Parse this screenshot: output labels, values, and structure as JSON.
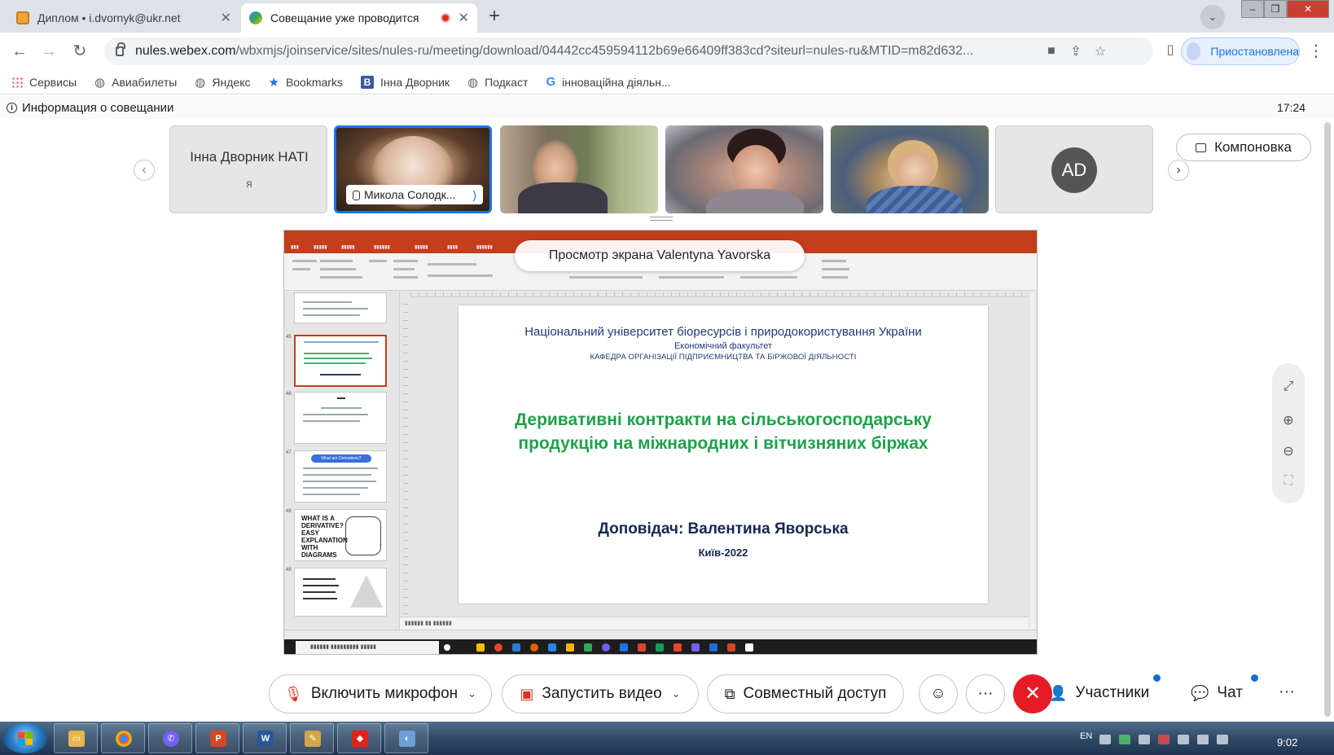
{
  "browser": {
    "tabs": [
      {
        "title": "Диплом • i.dvornyk@ukr.net"
      },
      {
        "title": "Совещание уже проводится"
      }
    ],
    "new_tab": "+",
    "address": {
      "host": "nules.webex.com",
      "path": "/wbxmjs/joinservice/sites/nules-ru/meeting/download/04442cc459594112b69e66409ff383cd?siteurl=nules-ru&MTID=m82d632..."
    },
    "profile_label": "Приостановлена",
    "bookmarks": [
      {
        "label": "Сервисы",
        "icon": "apps-grid-icon"
      },
      {
        "label": "Авиабилеты",
        "icon": "globe-icon"
      },
      {
        "label": "Яндекс",
        "icon": "globe-icon"
      },
      {
        "label": "Bookmarks",
        "icon": "star-icon"
      },
      {
        "label": "Інна Дворник",
        "icon": "b-icon"
      },
      {
        "label": "Подкаст",
        "icon": "globe-icon"
      },
      {
        "label": "інноваційна діяльн...",
        "icon": "google-icon"
      }
    ]
  },
  "meeting": {
    "info_label": "Информация о совещании",
    "time": "17:24",
    "participants": [
      {
        "name": "Інна Дворник НАТІ",
        "sub": "я"
      },
      {
        "name": "Микола Солодк..."
      },
      {
        "name": ""
      },
      {
        "name": ""
      },
      {
        "name": ""
      },
      {
        "initials": "AD"
      }
    ],
    "layout_label": "Компоновка",
    "viewing_label": "Просмотр экрана Valentyna Yavorska"
  },
  "slide": {
    "university": "Національний університет біоресурсів і природокористування України",
    "faculty": "Економічний факультет",
    "department": "КАФЕДРА ОРГАНІЗАЦІЇ ПІДПРИЄМНИЦТВА ТА БІРЖОВОЇ ДІЯЛЬНОСТІ",
    "title": "Деривативні контракти на сільськогосподарську продукцію на міжнародних і вітчизняних біржах",
    "speaker": "Доповідач: Валентина Яворська",
    "city_year": "Київ-2022",
    "thumb_texts": [
      "What are Derivatives?",
      "WHAT IS A DERIVATIVE? EASY EXPLANATION WITH DIAGRAMS"
    ],
    "thumb_numbers": [
      "45",
      "46",
      "47",
      "48",
      "49"
    ]
  },
  "controls": {
    "mic": "Включить микрофон",
    "video": "Запустить видео",
    "share": "Совместный доступ",
    "participants": "Участники",
    "chat": "Чат"
  },
  "taskbar": {
    "lang": "EN",
    "time": "9:02"
  },
  "colors": {
    "accent_blue": "#1a73e8",
    "end_red": "#e51b25",
    "slide_green": "#1ea14a",
    "slide_navy": "#1f3a78",
    "ppt_red": "#c43e1c"
  }
}
